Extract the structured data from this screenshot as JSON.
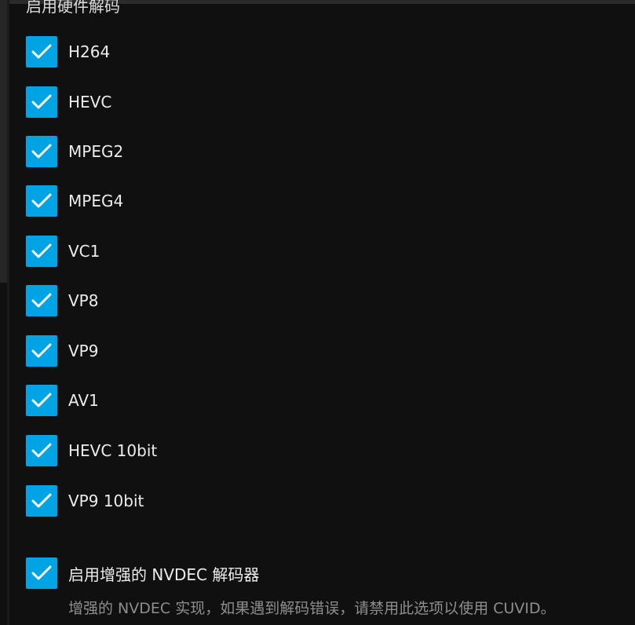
{
  "section": {
    "title": "启用硬件解码"
  },
  "codecs": [
    {
      "label": "H264",
      "checked": true
    },
    {
      "label": "HEVC",
      "checked": true
    },
    {
      "label": "MPEG2",
      "checked": true
    },
    {
      "label": "MPEG4",
      "checked": true
    },
    {
      "label": "VC1",
      "checked": true
    },
    {
      "label": "VP8",
      "checked": true
    },
    {
      "label": "VP9",
      "checked": true
    },
    {
      "label": "AV1",
      "checked": true
    },
    {
      "label": "HEVC 10bit",
      "checked": true
    },
    {
      "label": "VP9 10bit",
      "checked": true
    }
  ],
  "nvdec": {
    "label": "启用增强的 NVDEC 解码器",
    "checked": true,
    "description": "增强的 NVDEC 实现，如果遇到解码错误，请禁用此选项以使用 CUVID。"
  },
  "colors": {
    "background": "#101010",
    "checkbox_accent": "#00a4e4",
    "text": "#ececec",
    "description_text": "#8e8e8e"
  },
  "icons": {
    "check": "checkmark-icon"
  }
}
